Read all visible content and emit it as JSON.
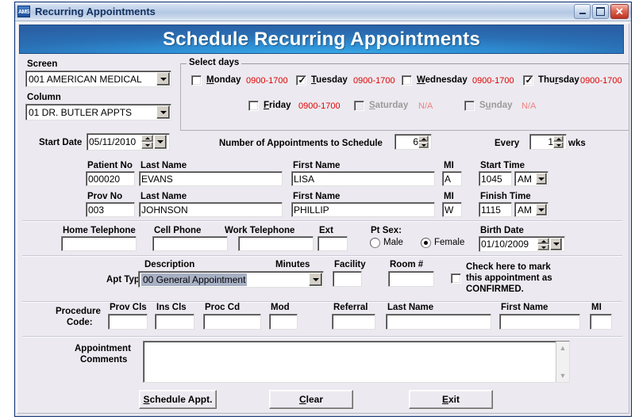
{
  "window": {
    "app_icon_label": "AMS",
    "title": "Recurring Appointments",
    "minimize_label": "Minimize",
    "maximize_label": "Maximize",
    "close_label": "✕"
  },
  "banner": {
    "title": "Schedule Recurring Appointments",
    "accent_color": "#2a61a6",
    "highlight_color": "#3fb4ec"
  },
  "screen_section": {
    "screen_label": "Screen",
    "screen_value": "001  AMERICAN MEDICAL",
    "column_label": "Column",
    "column_value": "01  DR. BUTLER APPTS"
  },
  "select_days": {
    "group_title": "Select days",
    "days": [
      {
        "name": "Monday",
        "accel": "M",
        "checked": false,
        "enabled": true,
        "hours": "0900-1700"
      },
      {
        "name": "Tuesday",
        "accel": "T",
        "checked": true,
        "enabled": true,
        "hours": "0900-1700"
      },
      {
        "name": "Wednesday",
        "accel": "W",
        "checked": false,
        "enabled": true,
        "hours": "0900-1700"
      },
      {
        "name": "Thursday",
        "accel": "r",
        "checked": true,
        "enabled": true,
        "hours": "0900-1700"
      },
      {
        "name": "Friday",
        "accel": "F",
        "checked": false,
        "enabled": true,
        "hours": "0900-1700"
      },
      {
        "name": "Saturday",
        "accel": "S",
        "checked": false,
        "enabled": false,
        "hours": "N/A"
      },
      {
        "name": "Sunday",
        "accel": "u",
        "checked": false,
        "enabled": false,
        "hours": "N/A"
      }
    ],
    "checkmark": "✓"
  },
  "schedule_row": {
    "start_date_label": "Start Date",
    "start_date_value": "05/11/2010",
    "num_appts_label": "Number of Appointments to Schedule",
    "num_appts_value": "6",
    "every_label": "Every",
    "every_value": "1",
    "wks_label": "wks"
  },
  "patient": {
    "patient_no_label": "Patient No",
    "patient_no_value": "000020",
    "last_name_label": "Last Name",
    "last_name_value": "EVANS",
    "first_name_label": "First Name",
    "first_name_value": "LISA",
    "mi_label": "MI",
    "mi_value": "A",
    "start_time_label": "Start Time",
    "start_time_value": "1045",
    "start_time_meridiem": "AM"
  },
  "provider": {
    "prov_no_label": "Prov No",
    "prov_no_value": "003",
    "last_name_label": "Last Name",
    "last_name_value": "JOHNSON",
    "first_name_label": "First Name",
    "first_name_value": "PHILLIP",
    "mi_label": "MI",
    "mi_value": "W",
    "finish_time_label": "Finish Time",
    "finish_time_value": "1115",
    "finish_time_meridiem": "AM"
  },
  "contact": {
    "home_phone_label": "Home Telephone",
    "home_phone_value": "",
    "cell_phone_label": "Cell Phone",
    "cell_phone_value": "",
    "work_phone_label": "Work Telephone",
    "work_phone_value": "",
    "ext_label": "Ext",
    "ext_value": "",
    "pt_sex_label": "Pt Sex:",
    "male_label": "Male",
    "female_label": "Female",
    "sex_selected": "Female",
    "birth_date_label": "Birth Date",
    "birth_date_value": "01/10/2009"
  },
  "appointment": {
    "apt_type_label": "Apt Type:",
    "description_label": "Description",
    "description_value": "00 General Appointment",
    "minutes_label": "Minutes",
    "minutes_value": "",
    "facility_label": "Facility",
    "facility_value": "",
    "room_label": "Room #",
    "room_value": "",
    "confirm_line1": "Check here to mark",
    "confirm_line2": "this appointment as",
    "confirm_line3": "CONFIRMED.",
    "confirm_checked": false
  },
  "procedure": {
    "label_line1": "Procedure",
    "label_line2": "Code:",
    "prov_cls_label": "Prov Cls",
    "prov_cls_value": "",
    "ins_cls_label": "Ins Cls",
    "ins_cls_value": "",
    "proc_cd_label": "Proc Cd",
    "proc_cd_value": "",
    "mod_label": "Mod",
    "mod_value": "",
    "referral_label": "Referral",
    "referral_value": "",
    "ref_last_name_label": "Last Name",
    "ref_last_name_value": "",
    "ref_first_name_label": "First Name",
    "ref_first_name_value": "",
    "ref_mi_label": "MI",
    "ref_mi_value": ""
  },
  "comments": {
    "label_line1": "Appointment",
    "label_line2": "Comments",
    "value": "",
    "scroll_up": "▲",
    "scroll_down": "▼"
  },
  "buttons": {
    "schedule": "Schedule Appt.",
    "schedule_accel": "S",
    "clear": "Clear",
    "clear_accel": "C",
    "exit": "Exit",
    "exit_accel": "E"
  }
}
